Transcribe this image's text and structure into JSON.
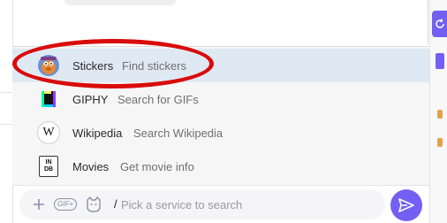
{
  "sticker_menu": {
    "items": [
      {
        "name": "Stickers",
        "description": "Find stickers",
        "icon": "stickers-mascot-icon",
        "active": true
      },
      {
        "name": "GIPHY",
        "description": "Search for GIFs",
        "icon": "giphy-icon",
        "active": false
      },
      {
        "name": "Wikipedia",
        "description": "Search Wikipedia",
        "icon": "wikipedia-icon",
        "active": false
      },
      {
        "name": "Movies",
        "description": "Get movie info",
        "icon": "imdb-icon",
        "active": false
      }
    ],
    "wikipedia_glyph": "W",
    "imdb_glyph_top": "IN",
    "imdb_glyph_bottom": "DB"
  },
  "composer": {
    "value": "/",
    "placeholder": "Pick a service to search",
    "icons": [
      "plus-icon",
      "gif-icon",
      "sticker-face-icon"
    ],
    "gif_label": "GIF+"
  },
  "colors": {
    "accent": "#7360f2",
    "highlight": "#d90b0b",
    "active_row": "#dfe9f3"
  }
}
